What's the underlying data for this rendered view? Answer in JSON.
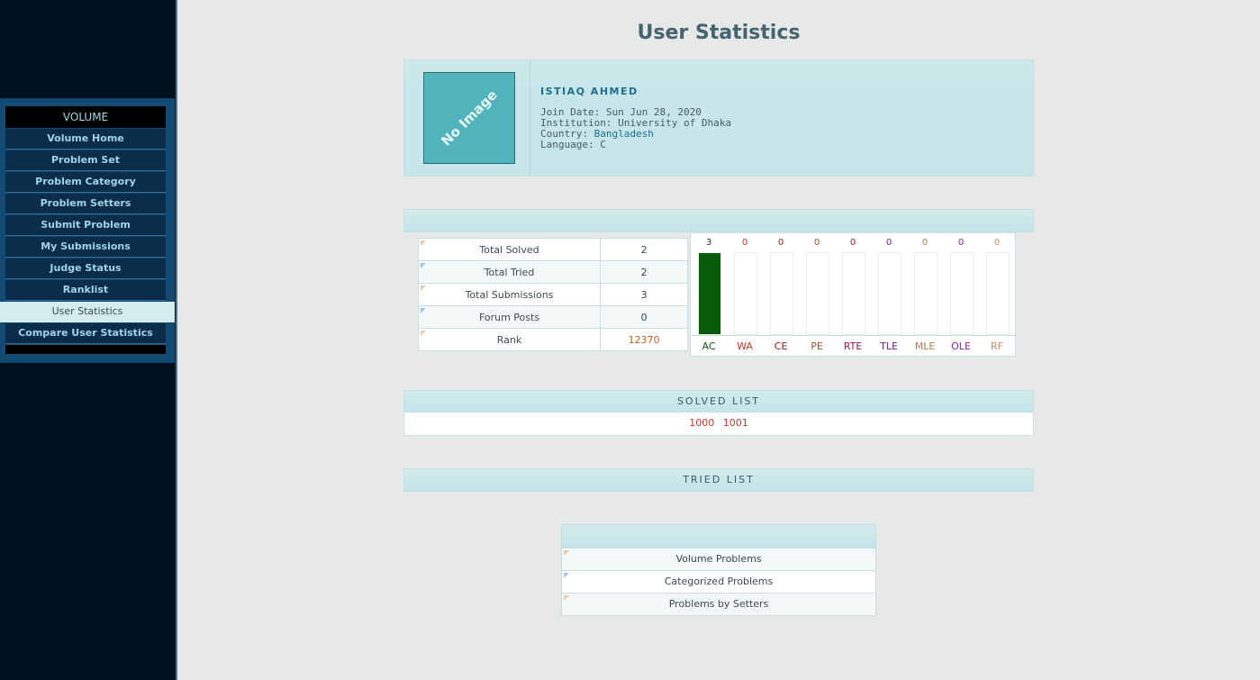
{
  "page": {
    "title": "User Statistics"
  },
  "sidebar": {
    "title": "VOLUME",
    "items": [
      {
        "label": "Volume Home",
        "active": false
      },
      {
        "label": "Problem Set",
        "active": false
      },
      {
        "label": "Problem Category",
        "active": false
      },
      {
        "label": "Problem Setters",
        "active": false
      },
      {
        "label": "Submit Problem",
        "active": false
      },
      {
        "label": "My Submissions",
        "active": false
      },
      {
        "label": "Judge Status",
        "active": false
      },
      {
        "label": "Ranklist",
        "active": false
      },
      {
        "label": "User Statistics",
        "active": true
      },
      {
        "label": "Compare User Statistics",
        "active": false
      }
    ]
  },
  "profile": {
    "avatar_text": "No Image",
    "name": "ISTIAQ AHMED",
    "join_label": "Join Date:",
    "join_date": "Sun Jun 28, 2020",
    "institution_label": "Institution:",
    "institution": "University of Dhaka",
    "country_label": "Country:",
    "country": "Bangladesh",
    "language_label": "Language:",
    "language": "C"
  },
  "stats": [
    {
      "label": "Total Solved",
      "value": "2"
    },
    {
      "label": "Total Tried",
      "value": "2"
    },
    {
      "label": "Total Submissions",
      "value": "3"
    },
    {
      "label": "Forum Posts",
      "value": "0"
    },
    {
      "label": "Rank",
      "value": "12370"
    }
  ],
  "chart_data": {
    "type": "bar",
    "categories": [
      "AC",
      "WA",
      "CE",
      "PE",
      "RTE",
      "TLE",
      "MLE",
      "OLE",
      "RF"
    ],
    "values": [
      3,
      0,
      0,
      0,
      0,
      0,
      0,
      0,
      0
    ],
    "ylim": [
      0,
      3
    ],
    "colors": [
      "#0a5c0a",
      "#c0392b",
      "#8b1a1a",
      "#a0522d",
      "#9b1b4b",
      "#7b1fa2",
      "#b07a50",
      "#8e24aa",
      "#c8905a"
    ],
    "fill_color": "#0a5c0a"
  },
  "solved_list": {
    "title": "SOLVED LIST",
    "problems": [
      "1000",
      "1001"
    ]
  },
  "tried_list": {
    "title": "TRIED LIST"
  },
  "links": [
    {
      "label": "Volume Problems"
    },
    {
      "label": "Categorized Problems"
    },
    {
      "label": "Problems by Setters"
    }
  ]
}
